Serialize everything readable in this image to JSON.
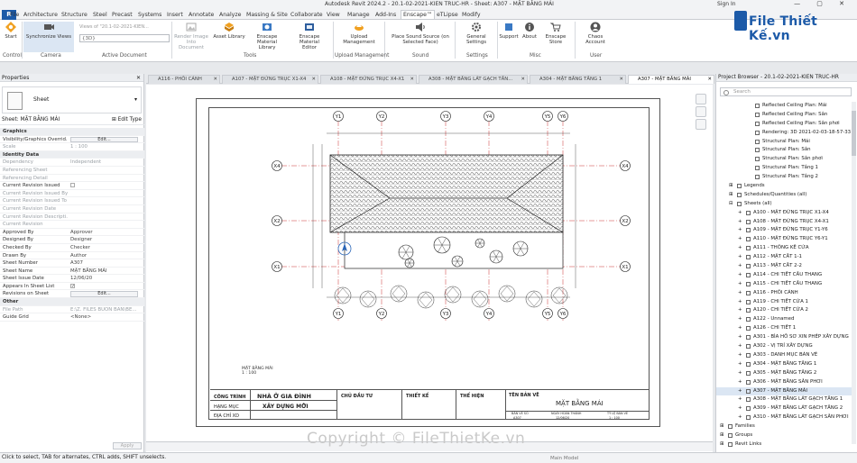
{
  "app": {
    "title": "Autodesk Revit 2024.2 - 20.1-02-2021-KIEN TRUC-HR - Sheet: A307 - MẶT BẰNG MÁI",
    "signin": "Sign In",
    "win_controls": "— ▢ ✕"
  },
  "ribbon_tabs": [
    {
      "label": "File"
    },
    {
      "label": "Architecture"
    },
    {
      "label": "Structure"
    },
    {
      "label": "Steel"
    },
    {
      "label": "Precast"
    },
    {
      "label": "Systems"
    },
    {
      "label": "Insert"
    },
    {
      "label": "Annotate"
    },
    {
      "label": "Analyze"
    },
    {
      "label": "Massing & Site"
    },
    {
      "label": "Collaborate"
    },
    {
      "label": "View"
    },
    {
      "label": "Manage"
    },
    {
      "label": "Add-Ins"
    },
    {
      "label": "Enscape™"
    },
    {
      "label": "eTLipse"
    },
    {
      "label": "Modify"
    }
  ],
  "ribbon": {
    "start": "Start",
    "sync_views": "Synchronize Views",
    "views_of_label": "Views of \"20.1-02-2021-KIEN...",
    "view_combo_value": "{3D}",
    "render_image": "Render Image",
    "render_image_2": "Into Document",
    "asset_library": "Asset Library",
    "enscape_material_library": "Enscape Material",
    "enscape_material_library_2": "Library",
    "enscape_material_editor": "Enscape Material",
    "enscape_material_editor_2": "Editor",
    "upload_management": "Upload",
    "upload_management_2": "Management",
    "place_sound_source": "Place Sound Source (on",
    "place_sound_source_2": "Selected Face)",
    "general_settings": "General Settings",
    "support": "Support",
    "about": "About",
    "enscape_store": "Enscape Store",
    "chaos_account": "Chaos Account",
    "panels": {
      "control": "Control",
      "camera": "Camera",
      "active_document": "Active Document",
      "tools": "Tools",
      "upload_management": "Upload Management",
      "sound": "Sound",
      "settings": "Settings",
      "misc": "Misc",
      "user": "User"
    }
  },
  "properties": {
    "header": "Properties",
    "type_name": "Sheet",
    "instance_label": "Sheet: MẶT BẰNG MÁI",
    "edit_type": "Edit Type",
    "rows": [
      {
        "k": "Graphics",
        "v": "",
        "kind": "sect"
      },
      {
        "k": "Visibility/Graphics Overrid...",
        "v": "Edit...",
        "kind": "btn"
      },
      {
        "k": "Scale",
        "v": "1 : 100",
        "kind": "grey"
      },
      {
        "k": "Identity Data",
        "v": "",
        "kind": "sect"
      },
      {
        "k": "Dependency",
        "v": "Independent",
        "kind": "grey"
      },
      {
        "k": "Referencing Sheet",
        "v": "",
        "kind": "grey"
      },
      {
        "k": "Referencing Detail",
        "v": "",
        "kind": "grey"
      },
      {
        "k": "Current Revision Issued",
        "v": "",
        "kind": "chk"
      },
      {
        "k": "Current Revision Issued By",
        "v": "",
        "kind": "grey"
      },
      {
        "k": "Current Revision Issued To",
        "v": "",
        "kind": "grey"
      },
      {
        "k": "Current Revision Date",
        "v": "",
        "kind": "grey"
      },
      {
        "k": "Current Revision Descripti...",
        "v": "",
        "kind": "grey"
      },
      {
        "k": "Current Revision",
        "v": "",
        "kind": "grey"
      },
      {
        "k": "Approved By",
        "v": "Approver",
        "kind": "n"
      },
      {
        "k": "Designed By",
        "v": "Designer",
        "kind": "n"
      },
      {
        "k": "Checked By",
        "v": "Checker",
        "kind": "n"
      },
      {
        "k": "Drawn By",
        "v": "Author",
        "kind": "n"
      },
      {
        "k": "Sheet Number",
        "v": "A307",
        "kind": "n"
      },
      {
        "k": "Sheet Name",
        "v": "MẶT BẰNG MÁI",
        "kind": "n"
      },
      {
        "k": "Sheet Issue Date",
        "v": "12/06/20",
        "kind": "n"
      },
      {
        "k": "Appears In Sheet List",
        "v": "",
        "kind": "chkon"
      },
      {
        "k": "Revisions on Sheet",
        "v": "Edit...",
        "kind": "btn"
      },
      {
        "k": "Other",
        "v": "",
        "kind": "sect"
      },
      {
        "k": "File Path",
        "v": "E:\\Z. FILES BUON BAN\\BE...",
        "kind": "grey"
      },
      {
        "k": "Guide Grid",
        "v": "<None>",
        "kind": "n"
      }
    ],
    "apply": "Apply"
  },
  "view_tabs": [
    {
      "label": "A116 - PHỐI CẢNH",
      "active": false
    },
    {
      "label": "A107 - MẶT ĐỨNG TRỤC X1-X4",
      "active": false
    },
    {
      "label": "A108 - MẶT ĐỨNG TRỤC X4-X1",
      "active": false
    },
    {
      "label": "A308 - MẶT BẰNG LÁT GẠCH TẦN...",
      "active": false
    },
    {
      "label": "A304 - MẶT BẰNG TẦNG 1",
      "active": false
    },
    {
      "label": "A307 - MẶT BẰNG MÁI",
      "active": true
    }
  ],
  "drawing": {
    "grid_top": [
      "Y1",
      "Y2",
      "Y3",
      "Y4",
      "Y5",
      "Y6"
    ],
    "grid_left": [
      "X4",
      "X2",
      "X1"
    ],
    "plan_label": "MẶT BẰNG MÁI",
    "plan_scale": "1 : 100",
    "titleblock": {
      "cong_trinh": "CÔNG TRÌNH",
      "nha_o": "NHÀ Ở GIA ĐÌNH",
      "hang_muc": "HẠNG MỤC",
      "xay_dung": "XÂY DỰNG MỚI",
      "dia_chi": "ĐỊA CHỈ XD",
      "chu_dau_tu": "CHỦ ĐẦU TƯ",
      "thiet_ke": "THIẾT KẾ",
      "the_hien": "THỂ HIỆN",
      "ten_ban_ve": "TÊN BẢN VẼ",
      "ten_value": "MẶT BẰNG MÁI",
      "ban_ve_so": "BẢN VẼ SỐ",
      "ngay": "NGÀY HOÀN THÀNH",
      "ty_le": "TỶ LỆ BẢN VẼ",
      "so_value": "A307",
      "ngay_value": "12/06/20",
      "tyle_value": "1 : 100"
    }
  },
  "project_browser": {
    "header": "Project Browser - 20.1-02-2021-KIEN TRUC-HR",
    "search_placeholder": "Search",
    "items": [
      {
        "label": "Reflected Ceiling Plan: Mái",
        "indent": 3,
        "sel": false
      },
      {
        "label": "Reflected Ceiling Plan: Sân",
        "indent": 3,
        "sel": false
      },
      {
        "label": "Reflected Ceiling Plan: Sân phơi",
        "indent": 3,
        "sel": false
      },
      {
        "label": "Rendering: 3D 2021-02-03-18-57-33 (E",
        "indent": 3,
        "sel": false
      },
      {
        "label": "Structural Plan: Mái",
        "indent": 3,
        "sel": false
      },
      {
        "label": "Structural Plan: Sân",
        "indent": 3,
        "sel": false
      },
      {
        "label": "Structural Plan: Sân phơi",
        "indent": 3,
        "sel": false
      },
      {
        "label": "Structural Plan: Tầng 1",
        "indent": 3,
        "sel": false
      },
      {
        "label": "Structural Plan: Tầng 2",
        "indent": 3,
        "sel": false
      },
      {
        "label": "Legends",
        "indent": 1,
        "sel": false
      },
      {
        "label": "Schedules/Quantities (all)",
        "indent": 1,
        "sel": false
      },
      {
        "label": "Sheets (all)",
        "indent": 1,
        "sel": false
      },
      {
        "label": "A100 - MẶT ĐỨNG TRỤC X1-X4",
        "indent": 2,
        "sel": false
      },
      {
        "label": "A108 - MẶT ĐỨNG TRỤC X4-X1",
        "indent": 2,
        "sel": false
      },
      {
        "label": "A109 - MẶT ĐỨNG TRỤC Y1-Y6",
        "indent": 2,
        "sel": false
      },
      {
        "label": "A110 - MẶT ĐỨNG TRỤC Y6-Y1",
        "indent": 2,
        "sel": false
      },
      {
        "label": "A111 - THỐNG KÊ CỬA",
        "indent": 2,
        "sel": false
      },
      {
        "label": "A112 - MẶT CẮT 1-1",
        "indent": 2,
        "sel": false
      },
      {
        "label": "A113 - MẶT CẮT 2-2",
        "indent": 2,
        "sel": false
      },
      {
        "label": "A114 - CHI TIẾT CẦU THANG",
        "indent": 2,
        "sel": false
      },
      {
        "label": "A115 - CHI TIẾT CẦU THANG",
        "indent": 2,
        "sel": false
      },
      {
        "label": "A116 - PHỐI CẢNH",
        "indent": 2,
        "sel": false
      },
      {
        "label": "A119 - CHI TIẾT CỬA 1",
        "indent": 2,
        "sel": false
      },
      {
        "label": "A120 - CHI TIẾT CỬA 2",
        "indent": 2,
        "sel": false
      },
      {
        "label": "A122 - Unnamed",
        "indent": 2,
        "sel": false
      },
      {
        "label": "A126 - CHI TIẾT 1",
        "indent": 2,
        "sel": false
      },
      {
        "label": "A301 - BÌA HỒ SƠ XIN PHÉP XÂY DỰNG",
        "indent": 2,
        "sel": false
      },
      {
        "label": "A302 - VỊ TRÍ XÂY DỰNG",
        "indent": 2,
        "sel": false
      },
      {
        "label": "A303 - DANH MỤC BẢN VẼ",
        "indent": 2,
        "sel": false
      },
      {
        "label": "A304 - MẶT BẰNG TẦNG 1",
        "indent": 2,
        "sel": false
      },
      {
        "label": "A305 - MẶT BẰNG TẦNG 2",
        "indent": 2,
        "sel": false
      },
      {
        "label": "A306 - MẶT BẰNG SÂN PHƠI",
        "indent": 2,
        "sel": false
      },
      {
        "label": "A307 - MẶT BẰNG MÁI",
        "indent": 2,
        "sel": true
      },
      {
        "label": "A308 - MẶT BẰNG LÁT GẠCH TẦNG 1",
        "indent": 2,
        "sel": false
      },
      {
        "label": "A309 - MẶT BẰNG LÁT GẠCH TẦNG 2",
        "indent": 2,
        "sel": false
      },
      {
        "label": "A310 - MẶT BẰNG LÁT GẠCH SÂN PHƠI",
        "indent": 2,
        "sel": false
      },
      {
        "label": "Families",
        "indent": 0,
        "sel": false
      },
      {
        "label": "Groups",
        "indent": 0,
        "sel": false
      },
      {
        "label": "Revit Links",
        "indent": 0,
        "sel": false
      }
    ]
  },
  "status": {
    "text": "Click to select, TAB for alternates, CTRL adds, SHIFT unselects.",
    "model": "Main Model"
  },
  "watermark": "Copyright © FileThietKe.vn",
  "logo": "File Thiết Kế.vn",
  "colors": {
    "accent": "#1c5aa8",
    "selection": "#dbe6f3",
    "grid_red": "#cc3333"
  }
}
